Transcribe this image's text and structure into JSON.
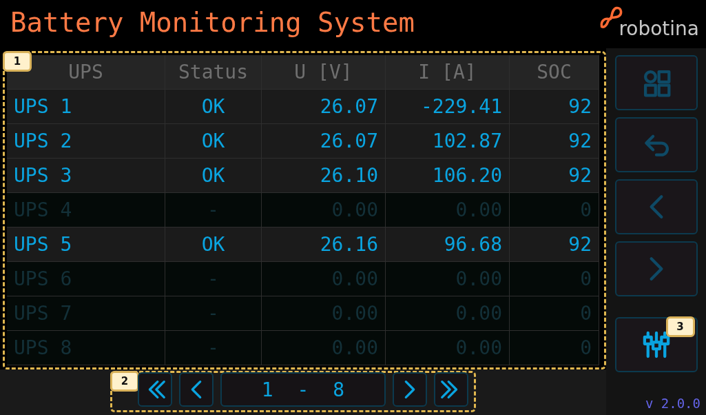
{
  "header": {
    "title": "Battery Monitoring System",
    "logo_text": "robotina"
  },
  "table": {
    "callout": "1",
    "columns": [
      "UPS",
      "Status",
      "U [V]",
      "I [A]",
      "SOC"
    ],
    "rows": [
      {
        "cells": [
          "UPS 1",
          "OK",
          "26.07",
          "-229.41",
          "92"
        ],
        "disabled": false
      },
      {
        "cells": [
          "UPS 2",
          "OK",
          "26.07",
          "102.87",
          "92"
        ],
        "disabled": false
      },
      {
        "cells": [
          "UPS 3",
          "OK",
          "26.10",
          "106.20",
          "92"
        ],
        "disabled": false
      },
      {
        "cells": [
          "UPS 4",
          "-",
          "0.00",
          "0.00",
          "0"
        ],
        "disabled": true
      },
      {
        "cells": [
          "UPS 5",
          "OK",
          "26.16",
          "96.68",
          "92"
        ],
        "disabled": false
      },
      {
        "cells": [
          "UPS 6",
          "-",
          "0.00",
          "0.00",
          "0"
        ],
        "disabled": true
      },
      {
        "cells": [
          "UPS 7",
          "-",
          "0.00",
          "0.00",
          "0"
        ],
        "disabled": true
      },
      {
        "cells": [
          "UPS 8",
          "-",
          "0.00",
          "0.00",
          "0"
        ],
        "disabled": true
      }
    ]
  },
  "pager": {
    "callout": "2",
    "range": "1 - 8",
    "buttons": [
      {
        "kind": "first"
      },
      {
        "kind": "prev"
      },
      {
        "kind": "range"
      },
      {
        "kind": "next"
      },
      {
        "kind": "last"
      }
    ]
  },
  "sidebar": {
    "buttons": [
      {
        "kind": "grid",
        "highlighted": false
      },
      {
        "kind": "back",
        "highlighted": false
      },
      {
        "kind": "prev",
        "highlighted": false
      },
      {
        "kind": "next",
        "highlighted": false
      },
      {
        "kind": "sliders",
        "highlighted": true,
        "callout": "3"
      }
    ],
    "version": "v 2.0.0"
  }
}
